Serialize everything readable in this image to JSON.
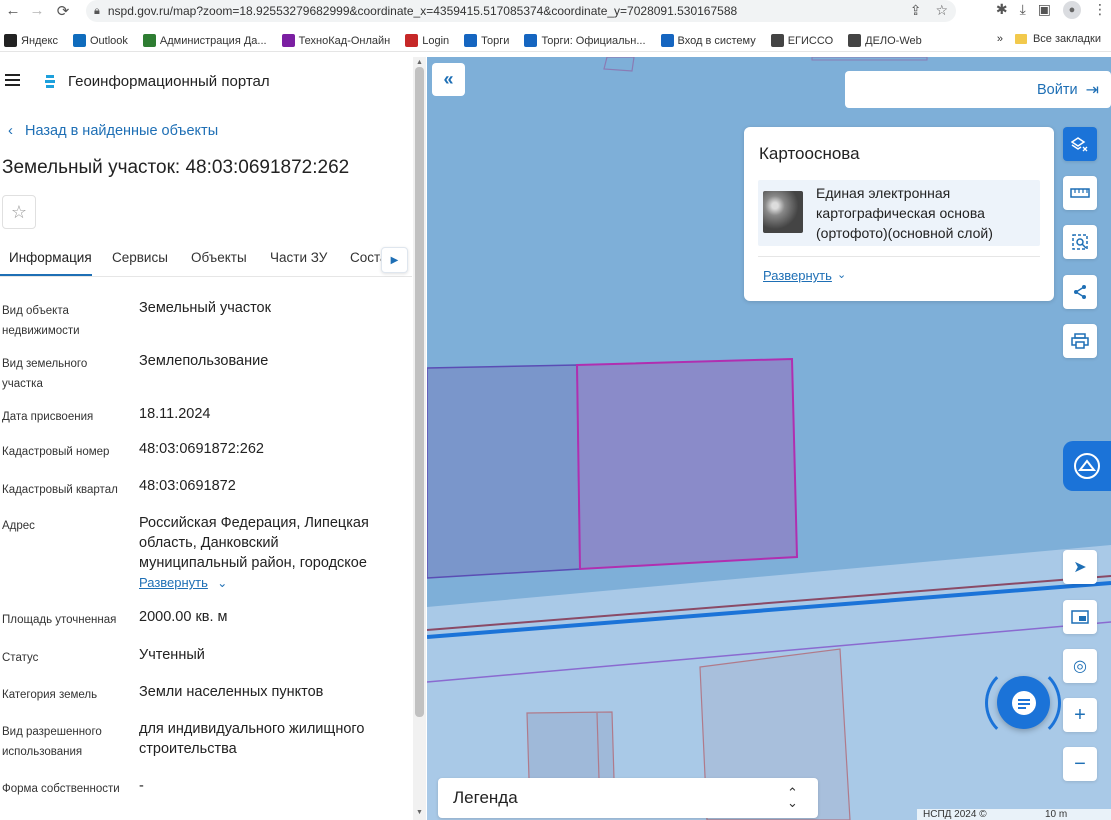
{
  "browser": {
    "back": "←",
    "forward": "→",
    "reload": "⟳",
    "url": "nspd.gov.ru/map?zoom=18.92553279682999&coordinate_x=4359415.517085374&coordinate_y=7028091.530167588",
    "bookmarks": [
      {
        "label": "Яндекс",
        "color": "#222222"
      },
      {
        "label": "Outlook",
        "color": "#0f6cbd"
      },
      {
        "label": "Администрация Да...",
        "color": "#2e7d32"
      },
      {
        "label": "ТехноКад-Онлайн",
        "color": "#7b1fa2"
      },
      {
        "label": "Login",
        "color": "#c62828"
      },
      {
        "label": "Торги",
        "color": "#1565c0"
      },
      {
        "label": "Торги: Официальн...",
        "color": "#1565c0"
      },
      {
        "label": "Вход в систему",
        "color": "#1565c0"
      },
      {
        "label": "ЕГИССО",
        "color": "#444444"
      },
      {
        "label": "ДЕЛО-Web",
        "color": "#444444"
      }
    ],
    "more_bookmarks": "»",
    "all_bookmarks": "Все закладки"
  },
  "sidebar": {
    "portal_title": "Геоинформационный портал",
    "back_link": "Назад в найденные объекты",
    "object_title": "Земельный участок: 48:03:0691872:262",
    "tabs": [
      "Информация",
      "Сервисы",
      "Объекты",
      "Части ЗУ",
      "Соста"
    ],
    "active_tab": "Информация",
    "attributes": [
      {
        "label": "Вид объекта недвижимости",
        "value": "Земельный участок"
      },
      {
        "label": "Вид земельного участка",
        "value": "Землепользование"
      },
      {
        "label": "Дата присвоения",
        "value": "18.11.2024"
      },
      {
        "label": "Кадастровый номер",
        "value": "48:03:0691872:262"
      },
      {
        "label": "Кадастровый квартал",
        "value": "48:03:0691872"
      },
      {
        "label": "Адрес",
        "value": "Российская Федерация, Липецкая область, Данковский муниципальный район, городское",
        "expand": "Развернуть"
      },
      {
        "label": "Площадь уточненная",
        "value": "2000.00 кв. м"
      },
      {
        "label": "Статус",
        "value": "Учтенный"
      },
      {
        "label": "Категория земель",
        "value": "Земли населенных пунктов"
      },
      {
        "label": "Вид разрешенного использования",
        "value": "для индивидуального жилищного строительства"
      },
      {
        "label": "Форма собственности",
        "value": "-"
      }
    ]
  },
  "map": {
    "login_label": "Войти",
    "basemap": {
      "title": "Картооснова",
      "layer_name": "Единая электронная картографическая основа (ортофото)(основной слой)",
      "expand_label": "Развернуть"
    },
    "legend_label": "Легенда",
    "attribution": "НСПД 2024 ©",
    "scale_label": "10 m",
    "colors": {
      "map_background": "#7eafd8",
      "parcel_selected_fill": "#8a8bc9",
      "parcel_selected_stroke": "#b02fb0",
      "accent_blue": "#1b73d8"
    }
  }
}
